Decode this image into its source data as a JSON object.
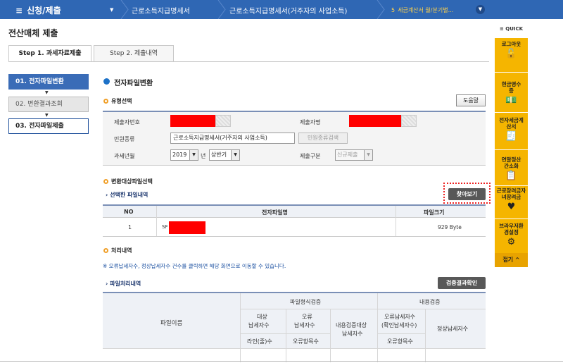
{
  "topnav": {
    "menu_label": "신청/제출",
    "crumb1": "근로소득지급명세서",
    "crumb2": "근로소득지급명세서(거주자의 사업소득)",
    "crumb3_num": "5",
    "crumb3": "세금계산서 월/분기별...",
    "bg_color": "#2f67b4"
  },
  "page_title": "전산매체 제출",
  "tabs": [
    "Step 1. 과세자료제출",
    "Step 2. 제출내역"
  ],
  "steps": [
    "01. 전자파일변환",
    "02. 변환결과조회",
    "03. 전자파일제출"
  ],
  "main": {
    "section_title": "전자파일변환",
    "type_select": "유형선택",
    "help_button": "도움말",
    "form": {
      "submitter_no_label": "제출자번호",
      "submitter_name_label": "제출자명",
      "civil_type_label": "민원종류",
      "civil_type_value": "근로소득지급명세서(거주자의 사업소득)",
      "civil_search_button": "민원종류검색",
      "tax_year_label": "과세년월",
      "year_value": "2019",
      "year_suffix": "년",
      "half_value": "상반기",
      "submit_type_label": "제출구분",
      "submit_type_value": "신규제출"
    },
    "file_select_title": "변환대상파일선택",
    "selected_file_title": "선택한 파일내역",
    "browse_button": "찾아보기",
    "file_table": {
      "headers": [
        "NO",
        "전자파일명",
        "파일크기"
      ],
      "rows": [
        {
          "no": "1",
          "name_prefix": "SF",
          "size": "929 Byte"
        }
      ]
    },
    "process_title": "처리내역",
    "notice": "※ 오류납세자수, 정상납세자수 건수를 클릭하면 해당 화면으로 이동할 수 있습니다.",
    "process_detail_title": "파일처리내역",
    "verify_button": "검증결과확인",
    "result_table": {
      "file_name": "파일이름",
      "format_check": "파일형식검증",
      "content_check": "내용검증",
      "target_taxpayers_1": "대상",
      "target_taxpayers_2": "납세자수",
      "error_taxpayers_1": "오류",
      "error_taxpayers_2": "납세자수",
      "content_target": "내용검증대상",
      "content_target_2": "납세자수",
      "error_confirm_1": "오류납세자수",
      "error_confirm_2": "(확인납세자수)",
      "normal_taxpayers": "정상납세자수",
      "line_count": "라인(줄)수",
      "error_items": "오류항목수",
      "error_items_2": "오류항목수"
    }
  },
  "quick": {
    "title": "≡ QUICK",
    "items": [
      "로그아웃",
      "현금영수증",
      "전자세금계산서",
      "연말정산간소화",
      "근로장려금자녀장려금",
      "브라우저환경설정"
    ],
    "close": "접기"
  }
}
